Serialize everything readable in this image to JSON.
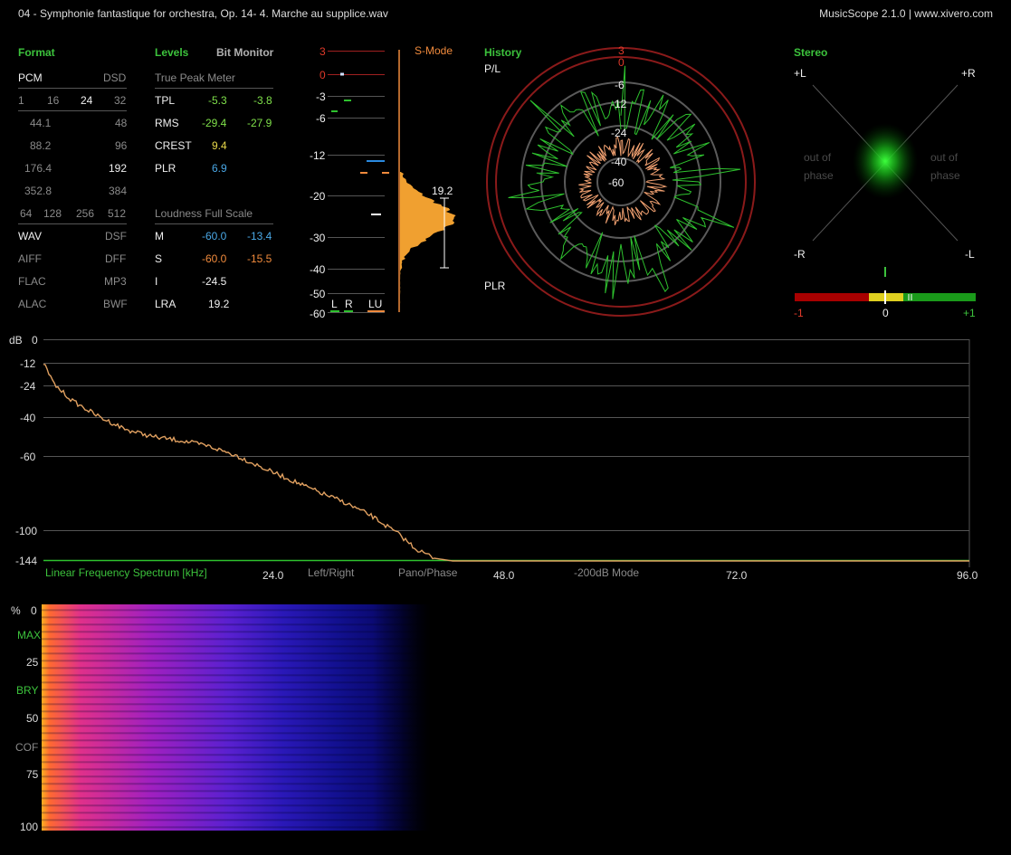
{
  "window": {
    "title": "04 - Symphonie fantastique for orchestra, Op. 14- 4. Marche au supplice.wav",
    "app": "MusicScope 2.1.0 | www.xivero.com"
  },
  "format": {
    "header": "Format",
    "pcm": "PCM",
    "dsd": "DSD",
    "bits": [
      "1",
      "16",
      "24",
      "32"
    ],
    "rates": [
      [
        "44.1",
        "48"
      ],
      [
        "88.2",
        "96"
      ],
      [
        "176.4",
        "192"
      ],
      [
        "352.8",
        "384"
      ]
    ],
    "dsd_rates": [
      "64",
      "128",
      "256",
      "512"
    ],
    "files": [
      [
        "WAV",
        "DSF"
      ],
      [
        "AIFF",
        "DFF"
      ],
      [
        "FLAC",
        "MP3"
      ],
      [
        "ALAC",
        "BWF"
      ]
    ]
  },
  "levels": {
    "header": "Levels",
    "bit_monitor": "Bit Monitor",
    "true_peak_meter": "True Peak Meter",
    "rows": [
      {
        "label": "TPL",
        "a": "-5.3",
        "b": "-3.8"
      },
      {
        "label": "RMS",
        "a": "-29.4",
        "b": "-27.9"
      },
      {
        "label": "CREST",
        "a": "9.4",
        "b": ""
      },
      {
        "label": "PLR",
        "a": "6.9",
        "b": ""
      }
    ],
    "loudness_header": "Loudness Full Scale",
    "loud_rows": [
      {
        "label": "M",
        "a": "-60.0",
        "b": "-13.4"
      },
      {
        "label": "S",
        "a": "-60.0",
        "b": "-15.5"
      },
      {
        "label": "I",
        "a": "-24.5",
        "b": ""
      },
      {
        "label": "LRA",
        "a": "19.2",
        "b": ""
      }
    ]
  },
  "meter": {
    "ticks": [
      "3",
      "0",
      "-3",
      "-6",
      "-12",
      "-20",
      "-30",
      "-40",
      "-50",
      "-60"
    ],
    "smode": "S-Mode",
    "lra_value": "19.2",
    "legend": [
      "L",
      "R",
      "LU"
    ]
  },
  "history": {
    "header": "History",
    "top_label": "P/L",
    "bottom_label": "PLR",
    "ring_labels": [
      "3",
      "0",
      "-6",
      "-12",
      "-24",
      "-40",
      "-60"
    ]
  },
  "stereo": {
    "header": "Stereo",
    "corners": [
      "+L",
      "+R",
      "-R",
      "-L"
    ],
    "out_of_phase": "out of phase",
    "scale": [
      "-1",
      "0",
      "+1"
    ]
  },
  "spectrum": {
    "db_label": "dB",
    "y_ticks": [
      "0",
      "-12",
      "-24",
      "-40",
      "-60",
      "-100",
      "-144"
    ],
    "title": "Linear Frequency Spectrum [kHz]",
    "x_ticks": [
      "24.0",
      "48.0",
      "72.0",
      "96.0"
    ],
    "modes": [
      "Left/Right",
      "Pano/Phase",
      "-200dB Mode"
    ]
  },
  "spectrogram": {
    "y_labels": [
      "%",
      "0",
      "MAX",
      "25",
      "BRY",
      "50",
      "COF",
      "75",
      "100"
    ]
  },
  "colors": {
    "accent_green": "#3cc23c",
    "orange": "#f08a3c",
    "blue": "#4aa8e6",
    "red": "#e03a2a"
  }
}
